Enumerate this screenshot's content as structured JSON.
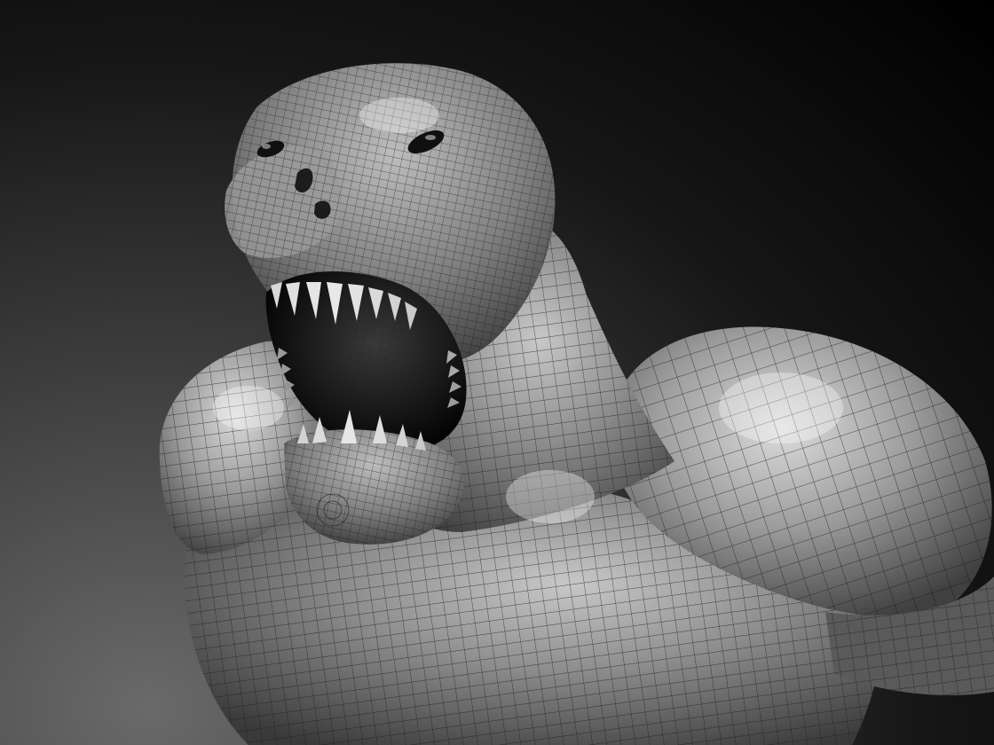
{
  "scene": {
    "subject": "sculpted-creature-wireframe-render",
    "background_colors": [
      "#000000",
      "#6a6a6a"
    ],
    "material_color": "#8c8c8c",
    "wire_color": "#1a1a1a",
    "mouth_color": "#0c0c0c",
    "tooth_color": "#d8d8d8"
  }
}
